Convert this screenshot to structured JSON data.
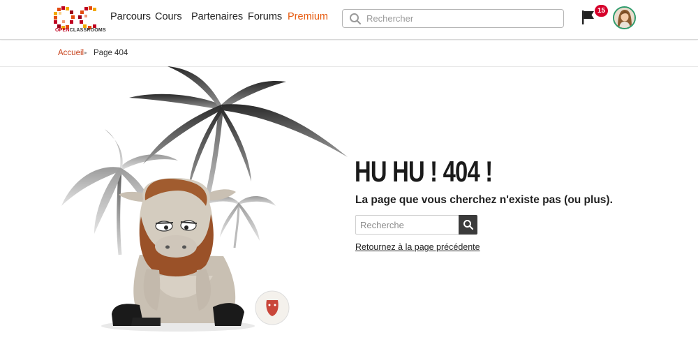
{
  "header": {
    "logo_text_red": "OPEN",
    "logo_text_dark": "CLASSROOMS",
    "nav": [
      {
        "label": "Parcours"
      },
      {
        "label": "Cours"
      },
      {
        "label": "Partenaires"
      },
      {
        "label": "Forums"
      },
      {
        "label": "Premium"
      }
    ],
    "search_placeholder": "Rechercher",
    "notifications_count": "15",
    "accent_color": "#e6580b",
    "badge_color": "#d6002a"
  },
  "breadcrumb": {
    "home": "Accueil",
    "separator": "▸",
    "current": "Page 404"
  },
  "error": {
    "title": "HU HU ! 404 !",
    "message": "La page que vous cherchez n'existe pas (ou plus).",
    "search_placeholder": "Recherche",
    "back_link": "Retournez à la page précédente"
  },
  "icons": [
    "oc-logo",
    "search-icon",
    "flag-icon",
    "avatar",
    "search-icon",
    "mascot-illustration",
    "palm-tree-illustration",
    "volleyball-illustration"
  ]
}
